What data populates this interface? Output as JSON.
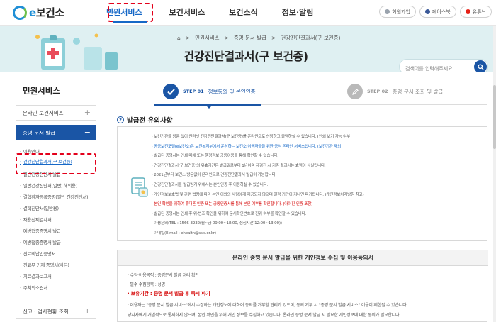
{
  "header": {
    "logo_text": "보건소",
    "logo_prefix": "e",
    "nav": [
      "민원서비스",
      "보건서비스",
      "보건소식",
      "정보·알림"
    ],
    "util": [
      {
        "label": "회원가입",
        "color": "#9aa3ad"
      },
      {
        "label": "페이스북",
        "color": "#3b5998"
      },
      {
        "label": "유튜브",
        "color": "#e62117"
      }
    ]
  },
  "banner": {
    "breadcrumb": [
      "민원서비스",
      "증명 문서 발급",
      "건강진단결과서(구 보건증)"
    ],
    "title": "건강진단결과서(구 보건증)",
    "search_placeholder": "검색어를 입력해주세요"
  },
  "sidebar": {
    "title": "민원서비스",
    "categories": [
      "온라인 보건서비스",
      "증명 문서 발급",
      "신고 · 검사현황 조회"
    ],
    "sub_items": [
      "이용안내",
      "건강진단결과서(구 보건증)",
      "일반건강진단서 발급",
      "일반건강진단서(일반, 해외용)",
      "결핵환자등록증명(일반 건강진단서)",
      "결핵진단서(일반용)",
      "채용신체검사서",
      "예방접종증명서 발급",
      "예방접종증명서 발급",
      "진료비납입증명서",
      "진료부 기재 증명서(사본)",
      "치료결과보고서",
      "주치의소견서"
    ]
  },
  "steps": [
    {
      "num": "STEP 01",
      "label": "정보동의 및 본인인증"
    },
    {
      "num": "STEP 02",
      "label": "증명 문서 조회 및 발급"
    }
  ],
  "notice": {
    "number": "2",
    "title": "발급전 유의사항",
    "lines": [
      {
        "text": "· 보건기관을 방문 없이 인터넷 건강진단결과서(구 보건증)를 온라인으로 신청하고 출력하실 수 있습니다. (인쇄 보기 가능 여부)",
        "style": ""
      },
      {
        "text": "· 공공보건포털(e보건소)은 보건복지부에서 운영하는 보건소 이용자들을 위한 공식 온라인 서비스입니다. (보건기관 제외)",
        "style": "blue"
      },
      {
        "text": "· 발급된 증명서는 인쇄 매체 또는 행정정보 공동이용을 통해 확인할 수 있습니다.",
        "style": ""
      },
      {
        "text": "· 건강진단결과서(구 보건증)의 유효기간은 발급일로부터 1년이며 재검진 시 기존 결과서는 효력이 상실됩니다.",
        "style": ""
      },
      {
        "text": "· 2021년부터 보건소 방문없이 온라인으로 건강진단결과서 발급이 가능합니다.",
        "style": ""
      },
      {
        "text": "· 건강진단결과서를 발급받기 위해서는 본인인증 후 이용하실 수 있습니다.",
        "style": ""
      },
      {
        "text": "· 개인정보보호법 및 관련 법령에 따라 본인 이외의 사람에게 제공되지 않으며 일정 기간이 지나면 파기됩니다. (개인정보처리방침 참고)",
        "style": ""
      },
      {
        "text": "· 본인 확인을 위하여 휴대폰 인증 또는 공동인증서를 통해 본인 여부를 확인합니다. (아이핀 인증 포함)",
        "style": "red"
      },
      {
        "text": "· 발급된 증명서는 인쇄 후 위·변조 확인을 위하여 문서확인번호로 진위 여부를 확인할 수 있습니다.",
        "style": ""
      },
      {
        "text": "· 이용문의(TEL : 1566-3232(월~금 09:00~18:00, 점심시간 12:00~13:00))",
        "style": ""
      },
      {
        "text": "· 이메일(E-mail : ehealth@ssis.or.kr)",
        "style": ""
      }
    ]
  },
  "consent": {
    "title": "온라인 증명 문서 발급을 위한 개인정보 수집 및 이용동의서",
    "lines": [
      {
        "text": "· 수집·이용목적 : 증명문서 발급 처리 확인",
        "style": ""
      },
      {
        "text": "· 필수 수집항목 : 성명",
        "style": ""
      },
      {
        "text": "· 보유기간 : 증명 문서 발급 후 즉시 파기",
        "style": "red"
      },
      {
        "text": "· 이용자는 \"증명 문서 발급 서비스\"에서 수집하는 개인정보에 대하여 동의를 거부할 권리가 있으며, 동의 거부 시 \"증명 문서 발급 서비스\" 이용이 제한될 수 있습니다.",
        "style": ""
      },
      {
        "text": "  당사자에게 개별적으로 통지하지 않으며, 본인 확인을 위해 개인 정보를 수집하고 있습니다. 온라인 증명 문서 발급 시 필요한 개인정보에 대한 동의가 필요합니다.",
        "style": ""
      }
    ]
  }
}
